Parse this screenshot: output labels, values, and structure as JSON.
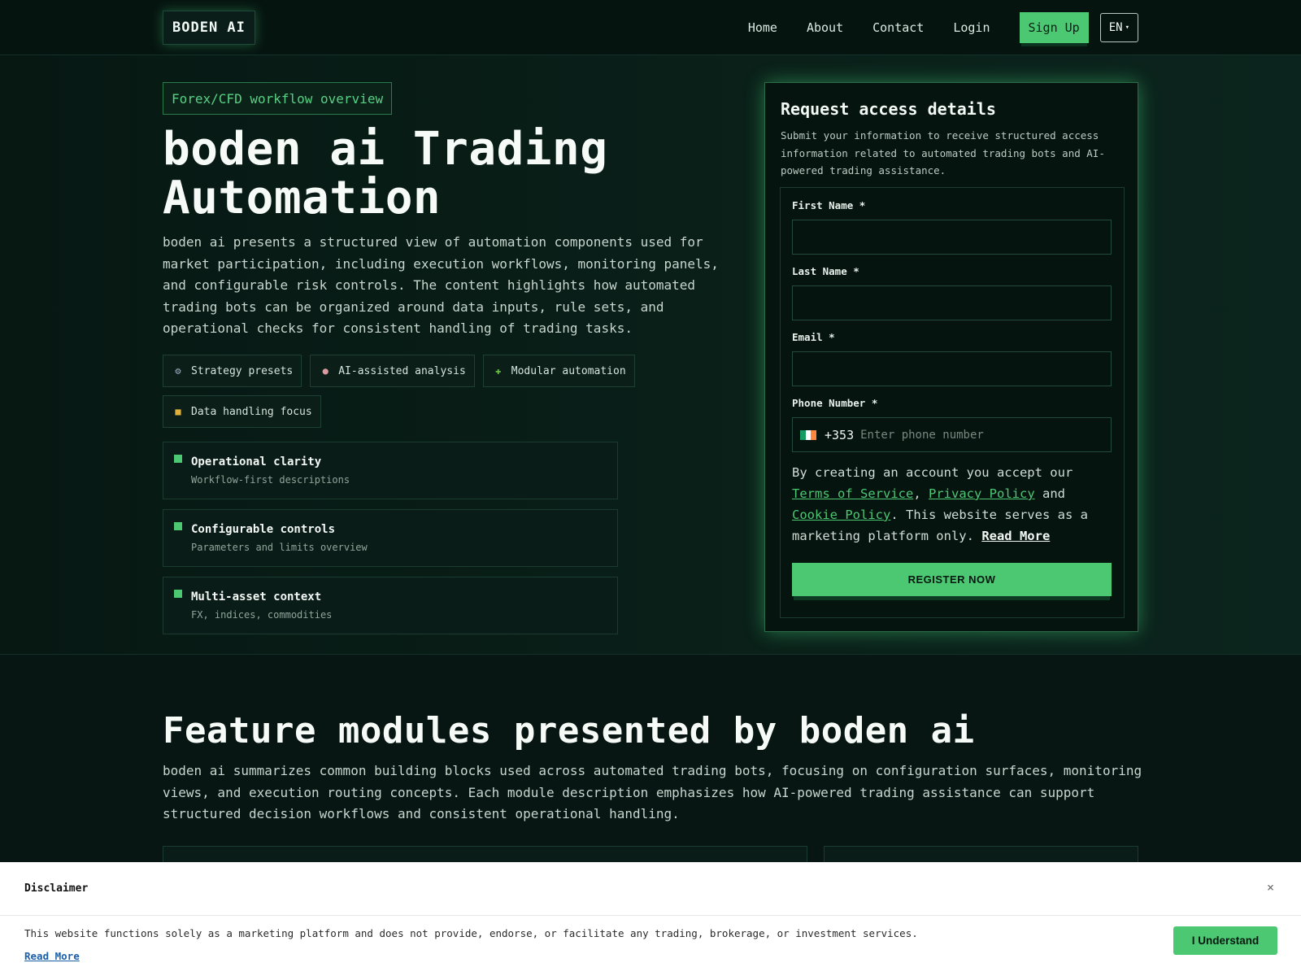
{
  "nav": {
    "logo": "BODEN AI",
    "links": [
      "Home",
      "About",
      "Contact",
      "Login"
    ],
    "signup": "Sign Up",
    "language": "EN",
    "language_caret": "▾"
  },
  "hero": {
    "pill": "Forex/CFD workflow overview",
    "title": "boden ai Trading Automation",
    "description": "boden ai presents a structured view of automation components used for market participation, including execution workflows, monitoring panels, and configurable risk controls. The content highlights how automated trading bots can be organized around data inputs, rule sets, and operational checks for consistent handling of trading tasks.",
    "chips": [
      {
        "icon": "gear-icon",
        "glyph": "⚙",
        "label": "Strategy presets"
      },
      {
        "icon": "brain-icon",
        "glyph": "●",
        "label": "AI-assisted analysis"
      },
      {
        "icon": "puzzle-icon",
        "glyph": "✚",
        "label": "Modular automation"
      },
      {
        "icon": "lock-icon",
        "glyph": "■",
        "label": "Data handling focus"
      }
    ],
    "features": [
      {
        "title": "Operational clarity",
        "subtitle": "Workflow-first descriptions"
      },
      {
        "title": "Configurable controls",
        "subtitle": "Parameters and limits overview"
      },
      {
        "title": "Multi-asset context",
        "subtitle": "FX, indices, commodities"
      }
    ]
  },
  "form": {
    "title": "Request access details",
    "subtitle": "Submit your information to receive structured access information related to automated trading bots and AI-powered trading assistance.",
    "first_name_label": "First Name *",
    "last_name_label": "Last Name *",
    "email_label": "Email *",
    "phone_label": "Phone Number *",
    "phone_code": "+353",
    "phone_placeholder": "Enter phone number",
    "terms_prefix": "By creating an account you accept our",
    "terms_link": "Terms of Service",
    "comma": ",",
    "privacy_link": "Privacy Policy",
    "and": "and",
    "cookie_link": "Cookie Policy",
    "terms_suffix": ". This website serves as a marketing platform only.",
    "read_more": "Read More",
    "register": "REGISTER NOW",
    "flag_colors": [
      "#169b62",
      "#ffffff",
      "#ff883e"
    ]
  },
  "modules": {
    "title": "Feature modules presented by boden ai",
    "description": "boden ai summarizes common building blocks used across automated trading bots, focusing on configuration surfaces, monitoring views, and execution routing concepts. Each module description emphasizes how AI-powered trading assistance can support structured decision workflows and consistent operational handling."
  },
  "disclaimer": {
    "title": "Disclaimer",
    "close": "×",
    "text": "This website functions solely as a marketing platform and does not provide, endorse, or facilitate any trading, brokerage, or investment services.",
    "read_more": "Read More",
    "button": "I Understand"
  },
  "colors": {
    "accent": "#4cc873",
    "background": "#071612"
  }
}
